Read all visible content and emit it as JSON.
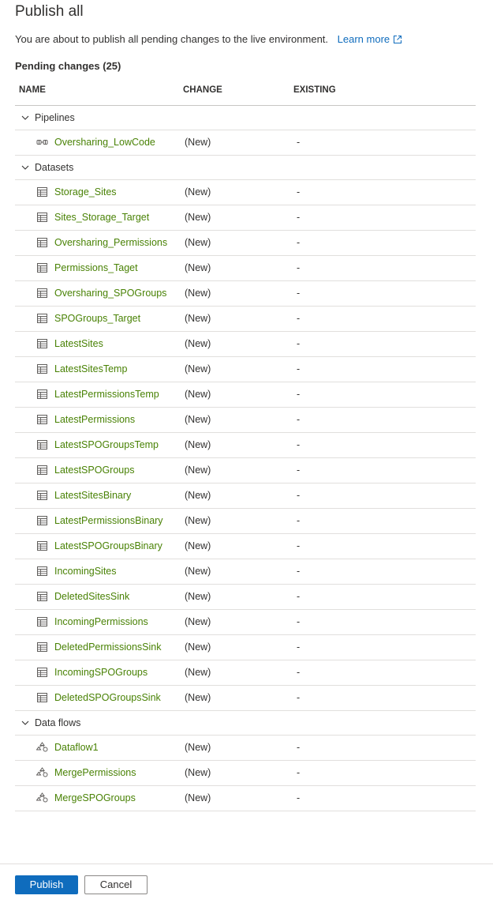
{
  "panel": {
    "title": "Publish all",
    "description": "You are about to publish all pending changes to the live environment.",
    "learn_more": "Learn more",
    "pending_label": "Pending changes (25)"
  },
  "columns": {
    "name": "NAME",
    "change": "CHANGE",
    "existing": "EXISTING"
  },
  "groups": [
    {
      "label": "Pipelines",
      "icon": "pipeline-icon",
      "items": [
        {
          "name": "Oversharing_LowCode",
          "change": "(New)",
          "existing": "-"
        }
      ]
    },
    {
      "label": "Datasets",
      "icon": "dataset-table-icon",
      "items": [
        {
          "name": "Storage_Sites",
          "change": "(New)",
          "existing": "-"
        },
        {
          "name": "Sites_Storage_Target",
          "change": "(New)",
          "existing": "-"
        },
        {
          "name": "Oversharing_Permissions",
          "change": "(New)",
          "existing": "-"
        },
        {
          "name": "Permissions_Taget",
          "change": "(New)",
          "existing": "-"
        },
        {
          "name": "Oversharing_SPOGroups",
          "change": "(New)",
          "existing": "-"
        },
        {
          "name": "SPOGroups_Target",
          "change": "(New)",
          "existing": "-"
        },
        {
          "name": "LatestSites",
          "change": "(New)",
          "existing": "-"
        },
        {
          "name": "LatestSitesTemp",
          "change": "(New)",
          "existing": "-"
        },
        {
          "name": "LatestPermissionsTemp",
          "change": "(New)",
          "existing": "-"
        },
        {
          "name": "LatestPermissions",
          "change": "(New)",
          "existing": "-"
        },
        {
          "name": "LatestSPOGroupsTemp",
          "change": "(New)",
          "existing": "-"
        },
        {
          "name": "LatestSPOGroups",
          "change": "(New)",
          "existing": "-"
        },
        {
          "name": "LatestSitesBinary",
          "change": "(New)",
          "existing": "-"
        },
        {
          "name": "LatestPermissionsBinary",
          "change": "(New)",
          "existing": "-"
        },
        {
          "name": "LatestSPOGroupsBinary",
          "change": "(New)",
          "existing": "-"
        },
        {
          "name": "IncomingSites",
          "change": "(New)",
          "existing": "-"
        },
        {
          "name": "DeletedSitesSink",
          "change": "(New)",
          "existing": "-"
        },
        {
          "name": "IncomingPermissions",
          "change": "(New)",
          "existing": "-"
        },
        {
          "name": "DeletedPermissionsSink",
          "change": "(New)",
          "existing": "-"
        },
        {
          "name": "IncomingSPOGroups",
          "change": "(New)",
          "existing": "-"
        },
        {
          "name": "DeletedSPOGroupsSink",
          "change": "(New)",
          "existing": "-"
        }
      ]
    },
    {
      "label": "Data flows",
      "icon": "dataflow-icon",
      "items": [
        {
          "name": "Dataflow1",
          "change": "(New)",
          "existing": "-"
        },
        {
          "name": "MergePermissions",
          "change": "(New)",
          "existing": "-"
        },
        {
          "name": "MergeSPOGroups",
          "change": "(New)",
          "existing": "-"
        }
      ]
    }
  ],
  "buttons": {
    "publish": "Publish",
    "cancel": "Cancel"
  },
  "colors": {
    "accent": "#0f6cbd",
    "item_link": "#498205"
  }
}
